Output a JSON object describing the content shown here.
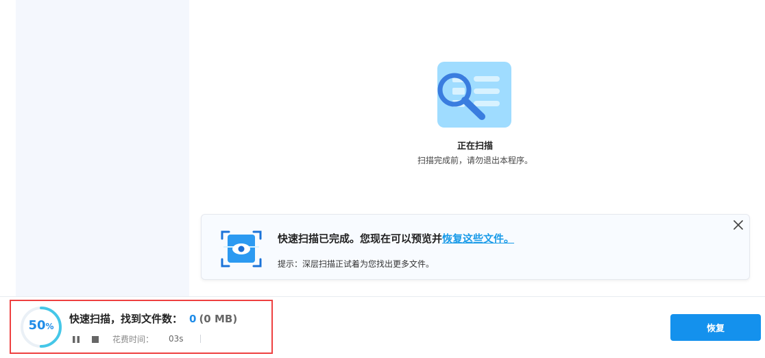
{
  "status": {
    "title": "正在扫描",
    "subtitle": "扫描完成前，请勿退出本程序。"
  },
  "notice": {
    "title_prefix": "快速扫描已完成。您现在可以预览并",
    "title_link": "恢复这些文件。",
    "hint": "提示：深层扫描正试着为您找出更多文件。"
  },
  "progress": {
    "value": 50,
    "display": "50",
    "unit": "%"
  },
  "summary": {
    "label": "快速扫描，找到文件数：",
    "count": "0",
    "size": "(0 MB)"
  },
  "timer": {
    "label": "花费时间：",
    "value": "03s"
  },
  "actions": {
    "recover": "恢复"
  },
  "colors": {
    "accent": "#1491ed",
    "highlight_box": "#ee3f3f",
    "progress_bg": "#eaf0f6",
    "progress_fg": "#45c7e8"
  },
  "icons": {
    "scan": "magnifier-list-icon",
    "preview": "eye-scan-icon",
    "close": "close-icon",
    "pause": "pause-icon",
    "stop": "stop-icon"
  }
}
